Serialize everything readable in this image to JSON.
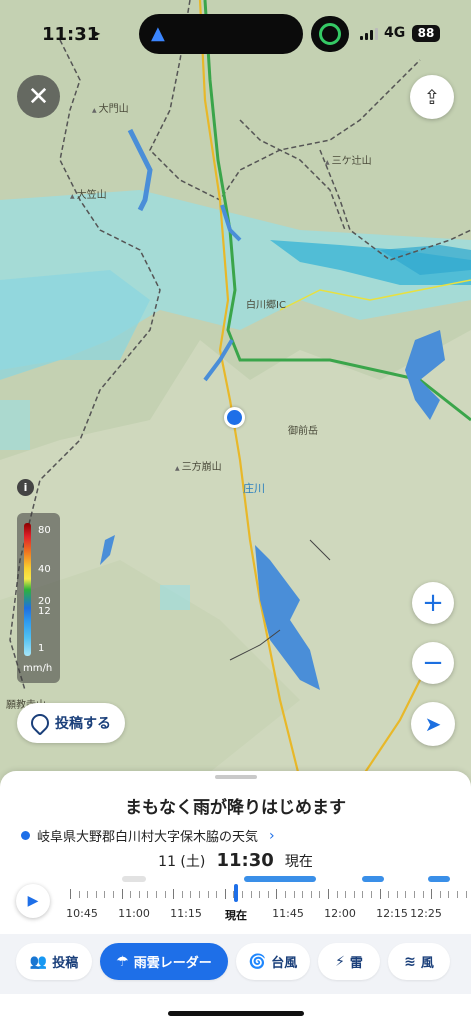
{
  "status_bar": {
    "time": "11:31",
    "network": "4G",
    "battery": "88"
  },
  "map": {
    "labels": {
      "daimonzan": "大門山",
      "ogasayama": "大笠山",
      "mitsugatsuji": "三ケ辻山",
      "shirakawago_ic": "白川郷IC",
      "gozengatake": "御前岳",
      "sanpoiwa": "三方崩山",
      "shogawa": "庄川",
      "kenjoji": "願教寺山"
    }
  },
  "legend": {
    "values": [
      "80",
      "40",
      "20",
      "12",
      "1"
    ],
    "unit": "mm/h"
  },
  "post_button": {
    "label": "投稿する"
  },
  "sheet": {
    "headline": "まもなく雨が降りはじめます",
    "location": "岐阜県大野郡白川村大字保木脇の天気",
    "date": "11 (土)",
    "time": "11:30",
    "now_label": "現在"
  },
  "timeline": {
    "labels": [
      "10:45",
      "11:00",
      "11:15",
      "現在",
      "11:45",
      "12:00",
      "12:15",
      "12:25"
    ]
  },
  "tabs": [
    {
      "label": "投稿",
      "icon": "people-icon"
    },
    {
      "label": "雨雲レーダー",
      "icon": "rain-cloud-icon",
      "active": true
    },
    {
      "label": "台風",
      "icon": "typhoon-icon"
    },
    {
      "label": "雷",
      "icon": "lightning-icon"
    },
    {
      "label": "風",
      "icon": "wind-icon"
    }
  ],
  "colors": {
    "accent": "#1e6fe8",
    "rain": "#7fd4df",
    "heavy_rain": "#3cb5d6"
  }
}
